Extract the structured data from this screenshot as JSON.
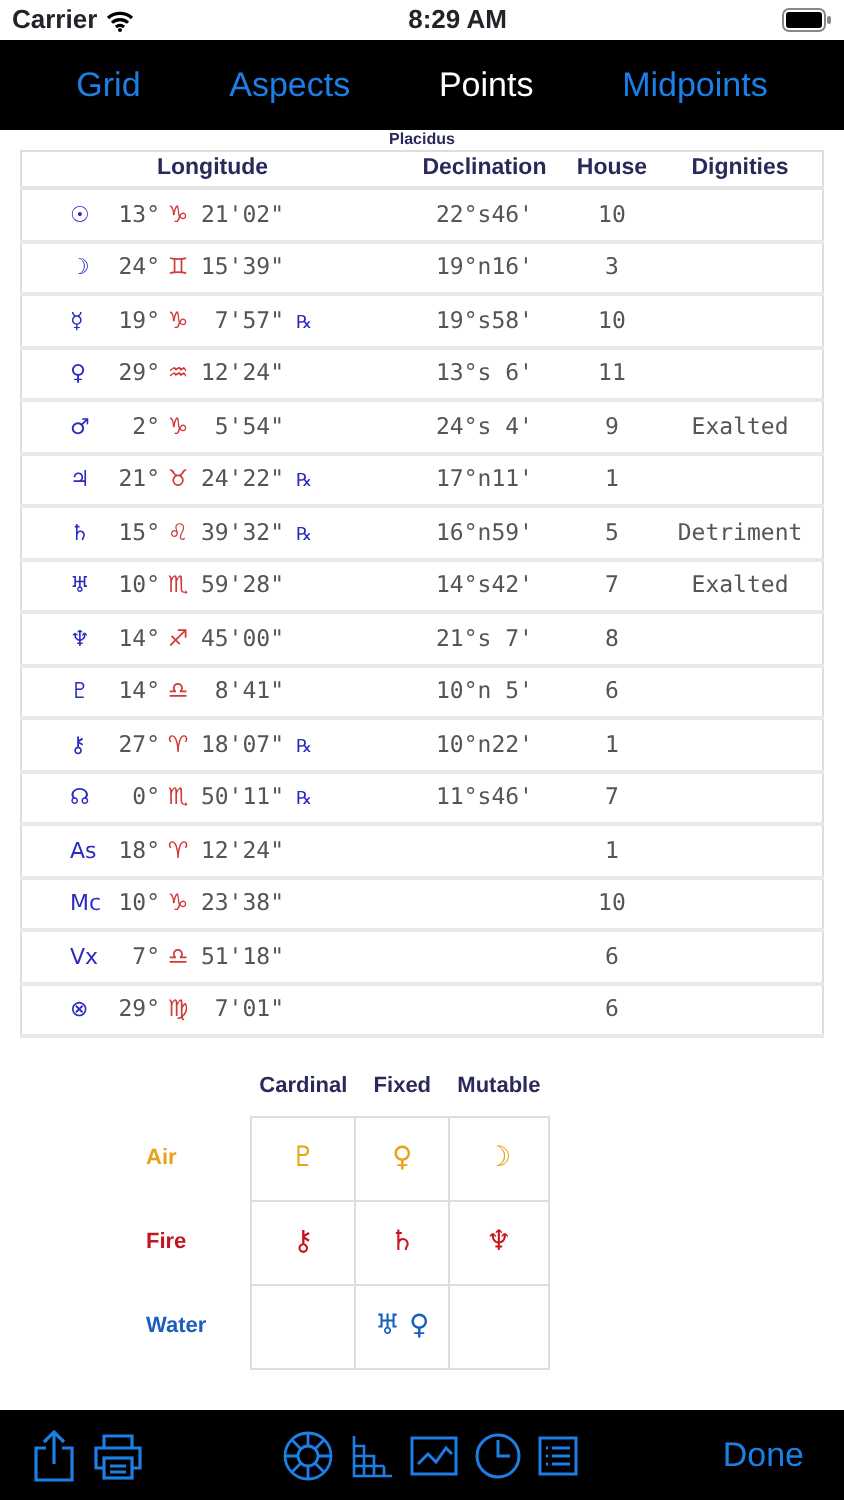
{
  "status_bar": {
    "carrier": "Carrier",
    "time": "8:29 AM"
  },
  "tabs": [
    {
      "label": "Grid",
      "selected": false
    },
    {
      "label": "Aspects",
      "selected": false
    },
    {
      "label": "Points",
      "selected": true
    },
    {
      "label": "Midpoints",
      "selected": false
    }
  ],
  "house_system": "Placidus",
  "table": {
    "columns": [
      "Longitude",
      "Declination",
      "House",
      "Dignities"
    ],
    "rows": [
      {
        "planet": "☉",
        "degree": "13°",
        "sign": "♑",
        "minutes": "21'02\"",
        "declination": "22°s46'",
        "house": "10"
      },
      {
        "planet": "☽",
        "degree": "24°",
        "sign": "♊",
        "minutes": "15'39\"",
        "declination": "19°n16'",
        "house": "3"
      },
      {
        "planet": "☿",
        "degree": "19°",
        "sign": "♑",
        "minutes": "7'57\"",
        "retrograde": "℞",
        "declination": "19°s58'",
        "house": "10"
      },
      {
        "planet": "♀",
        "degree": "29°",
        "sign": "♒",
        "minutes": "12'24\"",
        "declination": "13°s 6'",
        "house": "11"
      },
      {
        "planet": "♂",
        "degree": "2°",
        "sign": "♑",
        "minutes": "5'54\"",
        "declination": "24°s 4'",
        "house": "9",
        "dignity": "Exalted"
      },
      {
        "planet": "♃",
        "degree": "21°",
        "sign": "♉",
        "minutes": "24'22\"",
        "retrograde": "℞",
        "declination": "17°n11'",
        "house": "1"
      },
      {
        "planet": "♄",
        "degree": "15°",
        "sign": "♌",
        "minutes": "39'32\"",
        "retrograde": "℞",
        "declination": "16°n59'",
        "house": "5",
        "dignity": "Detriment"
      },
      {
        "planet": "♅",
        "degree": "10°",
        "sign": "♏",
        "minutes": "59'28\"",
        "declination": "14°s42'",
        "house": "7",
        "dignity": "Exalted"
      },
      {
        "planet": "♆",
        "degree": "14°",
        "sign": "♐",
        "minutes": "45'00\"",
        "declination": "21°s 7'",
        "house": "8"
      },
      {
        "planet": "♇",
        "degree": "14°",
        "sign": "♎",
        "minutes": "8'41\"",
        "declination": "10°n 5'",
        "house": "6"
      },
      {
        "planet": "⚷",
        "degree": "27°",
        "sign": "♈",
        "minutes": "18'07\"",
        "retrograde": "℞",
        "declination": "10°n22'",
        "house": "1"
      },
      {
        "planet": "☊",
        "degree": "0°",
        "sign": "♏",
        "minutes": "50'11\"",
        "retrograde": "℞",
        "declination": "11°s46'",
        "house": "7"
      },
      {
        "planet": "As",
        "degree": "18°",
        "sign": "♈",
        "minutes": "12'24\"",
        "house": "1"
      },
      {
        "planet": "Mc",
        "degree": "10°",
        "sign": "♑",
        "minutes": "23'38\"",
        "house": "10"
      },
      {
        "planet": "Vx",
        "degree": "7°",
        "sign": "♎",
        "minutes": "51'18\"",
        "house": "6"
      },
      {
        "planet": "⊗",
        "degree": "29°",
        "sign": "♍",
        "minutes": "7'01\"",
        "house": "6"
      }
    ]
  },
  "elements_grid": {
    "columns": [
      "Cardinal",
      "Fixed",
      "Mutable"
    ],
    "rows": [
      {
        "element": "Air",
        "color": "#e8a31a",
        "cells": [
          {
            "glyphs": "♇"
          },
          {
            "glyphs": "♀"
          },
          {
            "glyphs": "☽"
          }
        ]
      },
      {
        "element": "Fire",
        "color": "#c8141e",
        "cells": [
          {
            "glyphs": "⚷"
          },
          {
            "glyphs": "♄"
          },
          {
            "glyphs": "♆"
          }
        ]
      },
      {
        "element": "Water",
        "color": "#1a5fc0",
        "cells": [
          {},
          {
            "glyphs": "♅ ♀"
          },
          {}
        ]
      }
    ]
  },
  "toolbar": {
    "done": "Done"
  }
}
